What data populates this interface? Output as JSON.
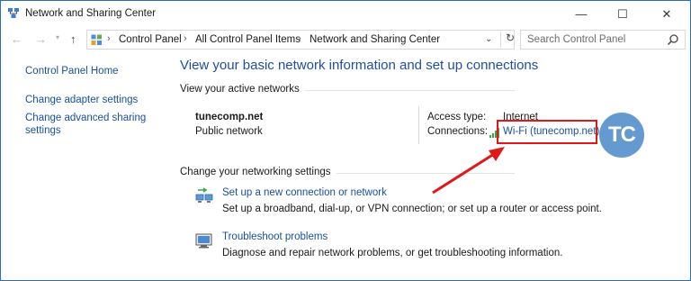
{
  "window": {
    "title": "Network and Sharing Center",
    "minimize_glyph": "—",
    "maximize_glyph": "☐",
    "close_glyph": "✕"
  },
  "nav": {
    "back_glyph": "←",
    "forward_glyph": "→",
    "dropdown_glyph": "▾",
    "up_glyph": "↑",
    "breadcrumb": [
      "Control Panel",
      "All Control Panel Items",
      "Network and Sharing Center"
    ],
    "separator_glyph": "›",
    "address_dropdown_glyph": "⌄",
    "refresh_glyph": "↻",
    "search_placeholder": "Search Control Panel"
  },
  "sidebar": {
    "items": [
      {
        "label": "Control Panel Home"
      },
      {
        "label": "Change adapter settings"
      },
      {
        "label": "Change advanced sharing settings"
      }
    ]
  },
  "main": {
    "title": "View your basic network information and set up connections",
    "active_networks_heading": "View your active networks",
    "network_name": "tunecomp.net",
    "network_category": "Public network",
    "access_type_label": "Access type:",
    "access_type_value": "Internet",
    "connections_label": "Connections:",
    "connection_link": "Wi-Fi (tunecomp.net)",
    "watermark_text": "TC",
    "change_settings_heading": "Change your networking settings",
    "tasks": [
      {
        "link": "Set up a new connection or network",
        "desc": "Set up a broadband, dial-up, or VPN connection; or set up a router or access point.",
        "icon": "new-connection-icon"
      },
      {
        "link": "Troubleshoot problems",
        "desc": "Diagnose and repair network problems, or get troubleshooting information.",
        "icon": "troubleshoot-icon"
      }
    ]
  },
  "colors": {
    "link": "#1a4fa0",
    "title_blue": "#1e4e9c",
    "highlight_red": "#e01818",
    "logo_blue": "#4a89c8"
  }
}
